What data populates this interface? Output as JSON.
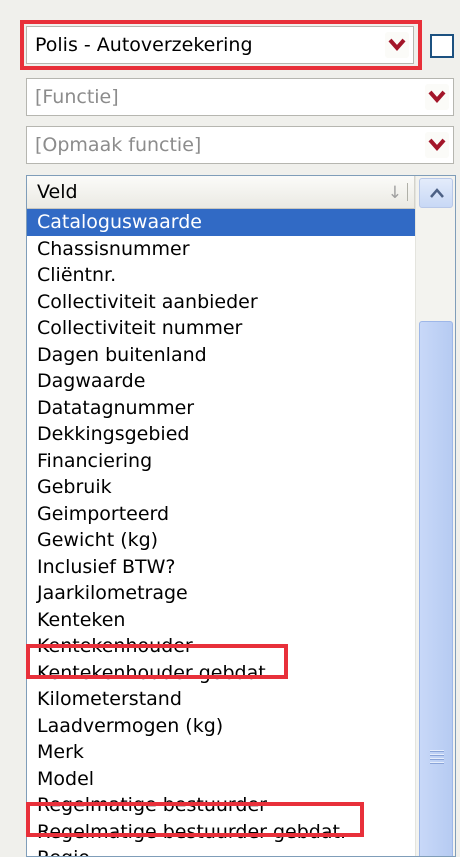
{
  "combos": {
    "primary": {
      "value": "Polis - Autoverzekering"
    },
    "function": {
      "placeholder": "[Functie]"
    },
    "format_function": {
      "placeholder": "[Opmaak functie]"
    }
  },
  "field_list": {
    "header": "Veld",
    "items": [
      "Cataloguswaarde",
      "Chassisnummer",
      "Cliëntnr.",
      "Collectiviteit aanbieder",
      "Collectiviteit nummer",
      "Dagen buitenland",
      "Dagwaarde",
      "Datatagnummer",
      "Dekkingsgebied",
      "Financiering",
      "Gebruik",
      "Geimporteerd",
      "Gewicht (kg)",
      "Inclusief BTW?",
      "Jaarkilometrage",
      "Kenteken",
      "Kentekenhouder",
      "Kentekenhouder gebdat.",
      "Kilometerstand",
      "Laadvermogen (kg)",
      "Merk",
      "Model",
      "Regelmatige bestuurder",
      "Regelmatige bestuurder gebdat.",
      "Regio"
    ],
    "selected_item": "Cataloguswaarde",
    "highlighted_items": [
      "Kentekenhouder gebdat.",
      "Regelmatige bestuurder gebdat."
    ]
  },
  "colors": {
    "selection": "#316ac5",
    "highlight_box": "#e8303a",
    "dropdown_arrow": "#a3162a"
  },
  "icons": {
    "dropdown": "chevron-down-icon",
    "sort": "sort-down-arrow-icon",
    "scroll_up": "chevron-up-icon"
  }
}
